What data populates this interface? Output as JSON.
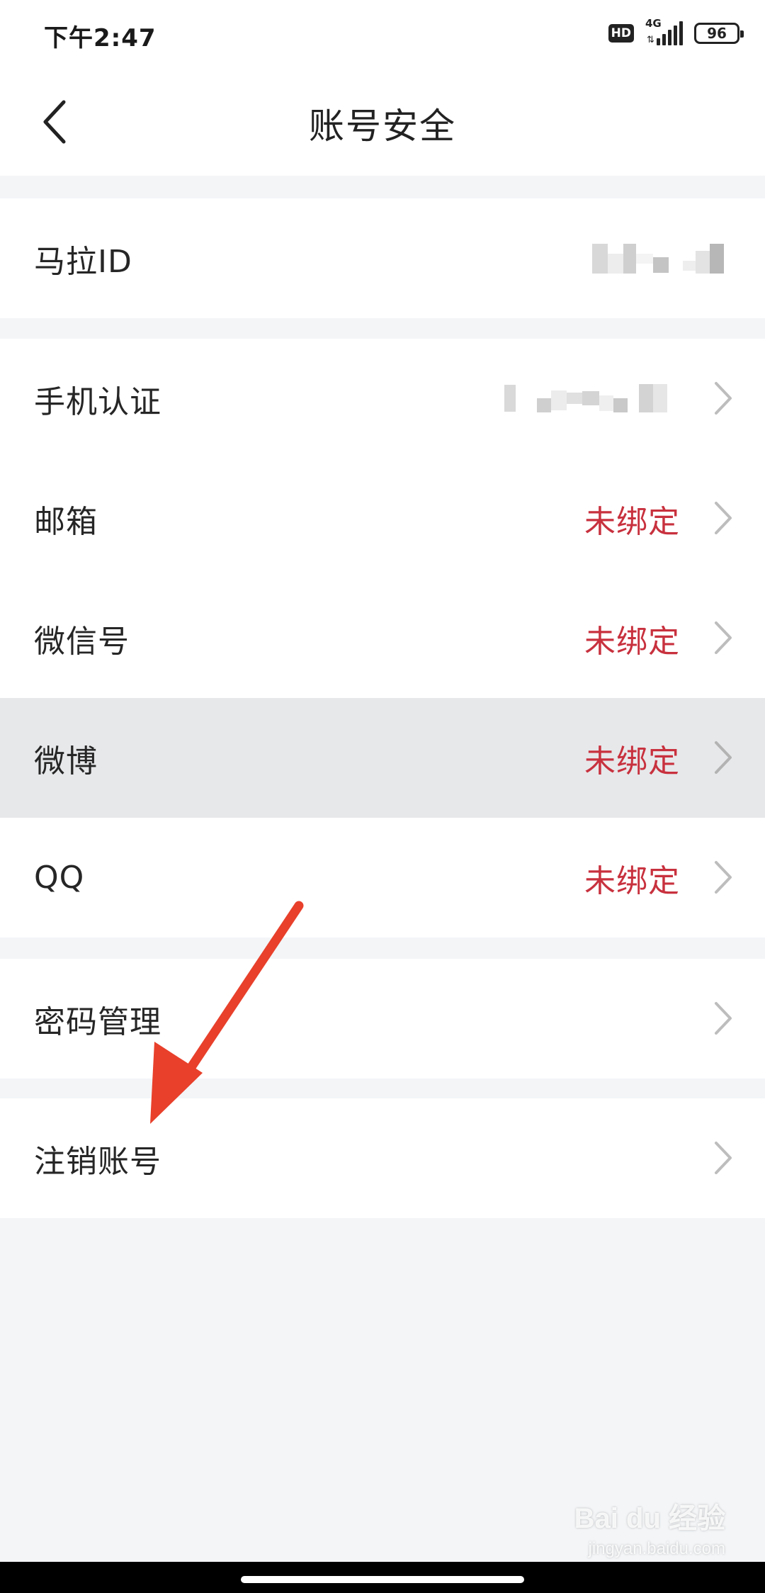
{
  "status_bar": {
    "time": "下午2:47",
    "hd": "HD",
    "network": "4G",
    "battery": "96"
  },
  "nav": {
    "title": "账号安全"
  },
  "groups": {
    "account": {
      "mala_id_label": "马拉ID"
    },
    "bindings": {
      "phone_label": "手机认证",
      "email_label": "邮箱",
      "email_value": "未绑定",
      "wechat_label": "微信号",
      "wechat_value": "未绑定",
      "weibo_label": "微博",
      "weibo_value": "未绑定",
      "qq_label": "QQ",
      "qq_value": "未绑定"
    },
    "password": {
      "label": "密码管理"
    },
    "cancel": {
      "label": "注销账号"
    }
  },
  "watermark": {
    "brand": "Bai du 经验",
    "site": "jingyan.baidu.com"
  },
  "colors": {
    "accent_unbound": "#c8313e",
    "annotation_arrow": "#e8402b",
    "background": "#f3f5f7",
    "pressed_row": "#e7e8ea"
  }
}
